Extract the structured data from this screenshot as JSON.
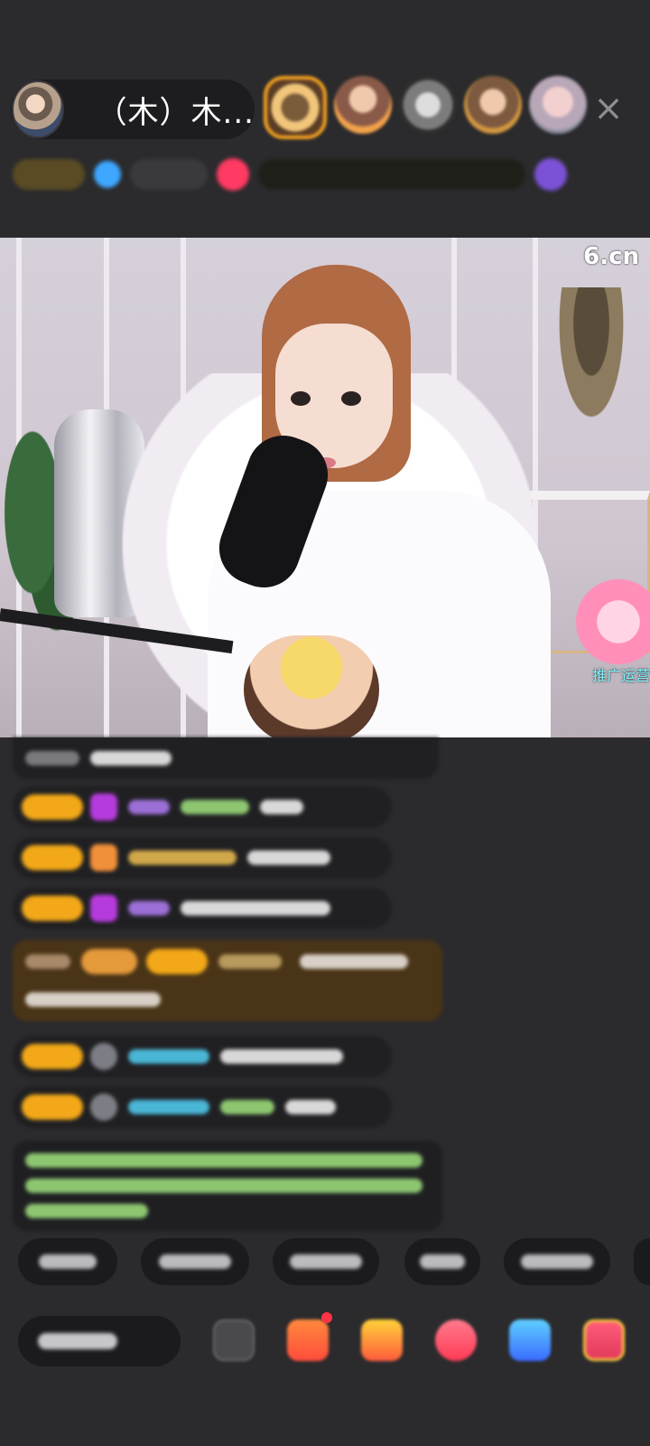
{
  "header": {
    "host_name": "（木）木...",
    "close_glyph": "×",
    "viewer_avatars": [
      "viewer-1",
      "viewer-2",
      "viewer-3",
      "viewer-4",
      "viewer-5"
    ]
  },
  "video": {
    "brand_logo": "6.cn",
    "promo_label": "推广运营"
  },
  "colors": {
    "background": "#2b2b2d",
    "level_badge": "#f2a818",
    "highlight_message": "#4a3417",
    "system_message_text": "#8ec670"
  },
  "icons": {
    "close": "close-icon",
    "gift": "gift-icon",
    "emoji": "emoji-icon",
    "game": "gamepad-icon"
  }
}
